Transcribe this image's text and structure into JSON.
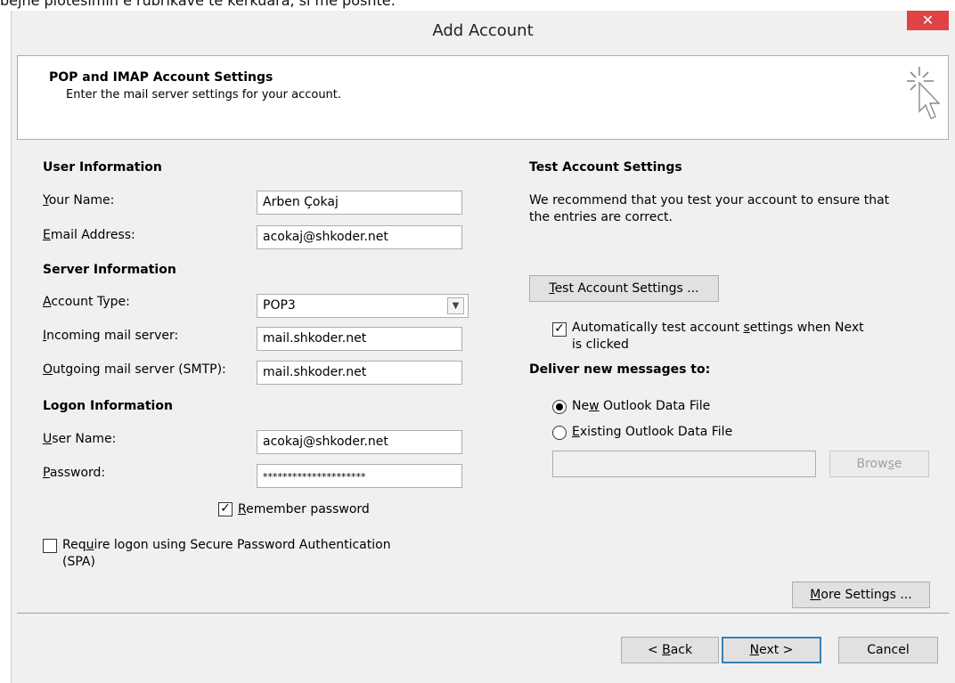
{
  "background_text": "bejnë plotësimin e rubrikave të kërkuara, si më poshtë:",
  "window": {
    "title": "Add Account",
    "close_symbol": "✕"
  },
  "header": {
    "title": "POP and IMAP Account Settings",
    "subtitle": "Enter the mail server settings for your account.",
    "icon": "cursor-sparkle-icon"
  },
  "user_information": {
    "heading": "User Information",
    "your_name": {
      "label_first": "Y",
      "label_rest": "our Name:",
      "value": "Arben Çokaj"
    },
    "email": {
      "label_first": "E",
      "label_rest": "mail Address:",
      "value": "acokaj@shkoder.net"
    }
  },
  "server_information": {
    "heading": "Server Information",
    "account_type": {
      "label_first": "A",
      "label_rest": "ccount Type:",
      "value": "POP3"
    },
    "incoming": {
      "label_first": "I",
      "label_rest": "ncoming mail server:",
      "value": "mail.shkoder.net"
    },
    "outgoing": {
      "label_first": "O",
      "label_rest": "utgoing mail server (SMTP):",
      "value": "mail.shkoder.net"
    }
  },
  "logon_information": {
    "heading": "Logon Information",
    "user_name": {
      "label_first": "U",
      "label_rest": "ser Name:",
      "value": "acokaj@shkoder.net"
    },
    "password": {
      "label_first": "P",
      "label_rest": "assword:",
      "value": "*********************"
    },
    "remember": {
      "label_first": "R",
      "label_rest": "emember password",
      "checked": true
    },
    "spa": {
      "label_pre": "Req",
      "label_u": "u",
      "label_post": "ire logon using Secure Password Authentication",
      "label_line2": "(SPA)",
      "checked": false
    }
  },
  "test_settings": {
    "heading": "Test Account Settings",
    "desc_line1": "We recommend that you test your account to ensure that",
    "desc_line2": "the entries are correct.",
    "button_first": "T",
    "button_rest": "est Account Settings ...",
    "auto_test": {
      "pre": "Automatically test account ",
      "u": "s",
      "post": "ettings when Next",
      "line2": "is clicked",
      "checked": true
    }
  },
  "deliver": {
    "heading": "Deliver new messages to:",
    "new_file": {
      "pre": "Ne",
      "u": "w",
      "post": " Outlook Data File",
      "selected": true
    },
    "existing_file": {
      "pre": "",
      "u": "E",
      "post": "xisting Outlook Data File",
      "selected": false
    },
    "path_value": "",
    "browse_pre": "Brow",
    "browse_u": "s",
    "browse_post": "e"
  },
  "more_settings": {
    "first": "M",
    "rest": "ore Settings ..."
  },
  "footer": {
    "back_pre": "< ",
    "back_u": "B",
    "back_post": "ack",
    "next_u": "N",
    "next_post": "ext >",
    "cancel": "Cancel"
  }
}
